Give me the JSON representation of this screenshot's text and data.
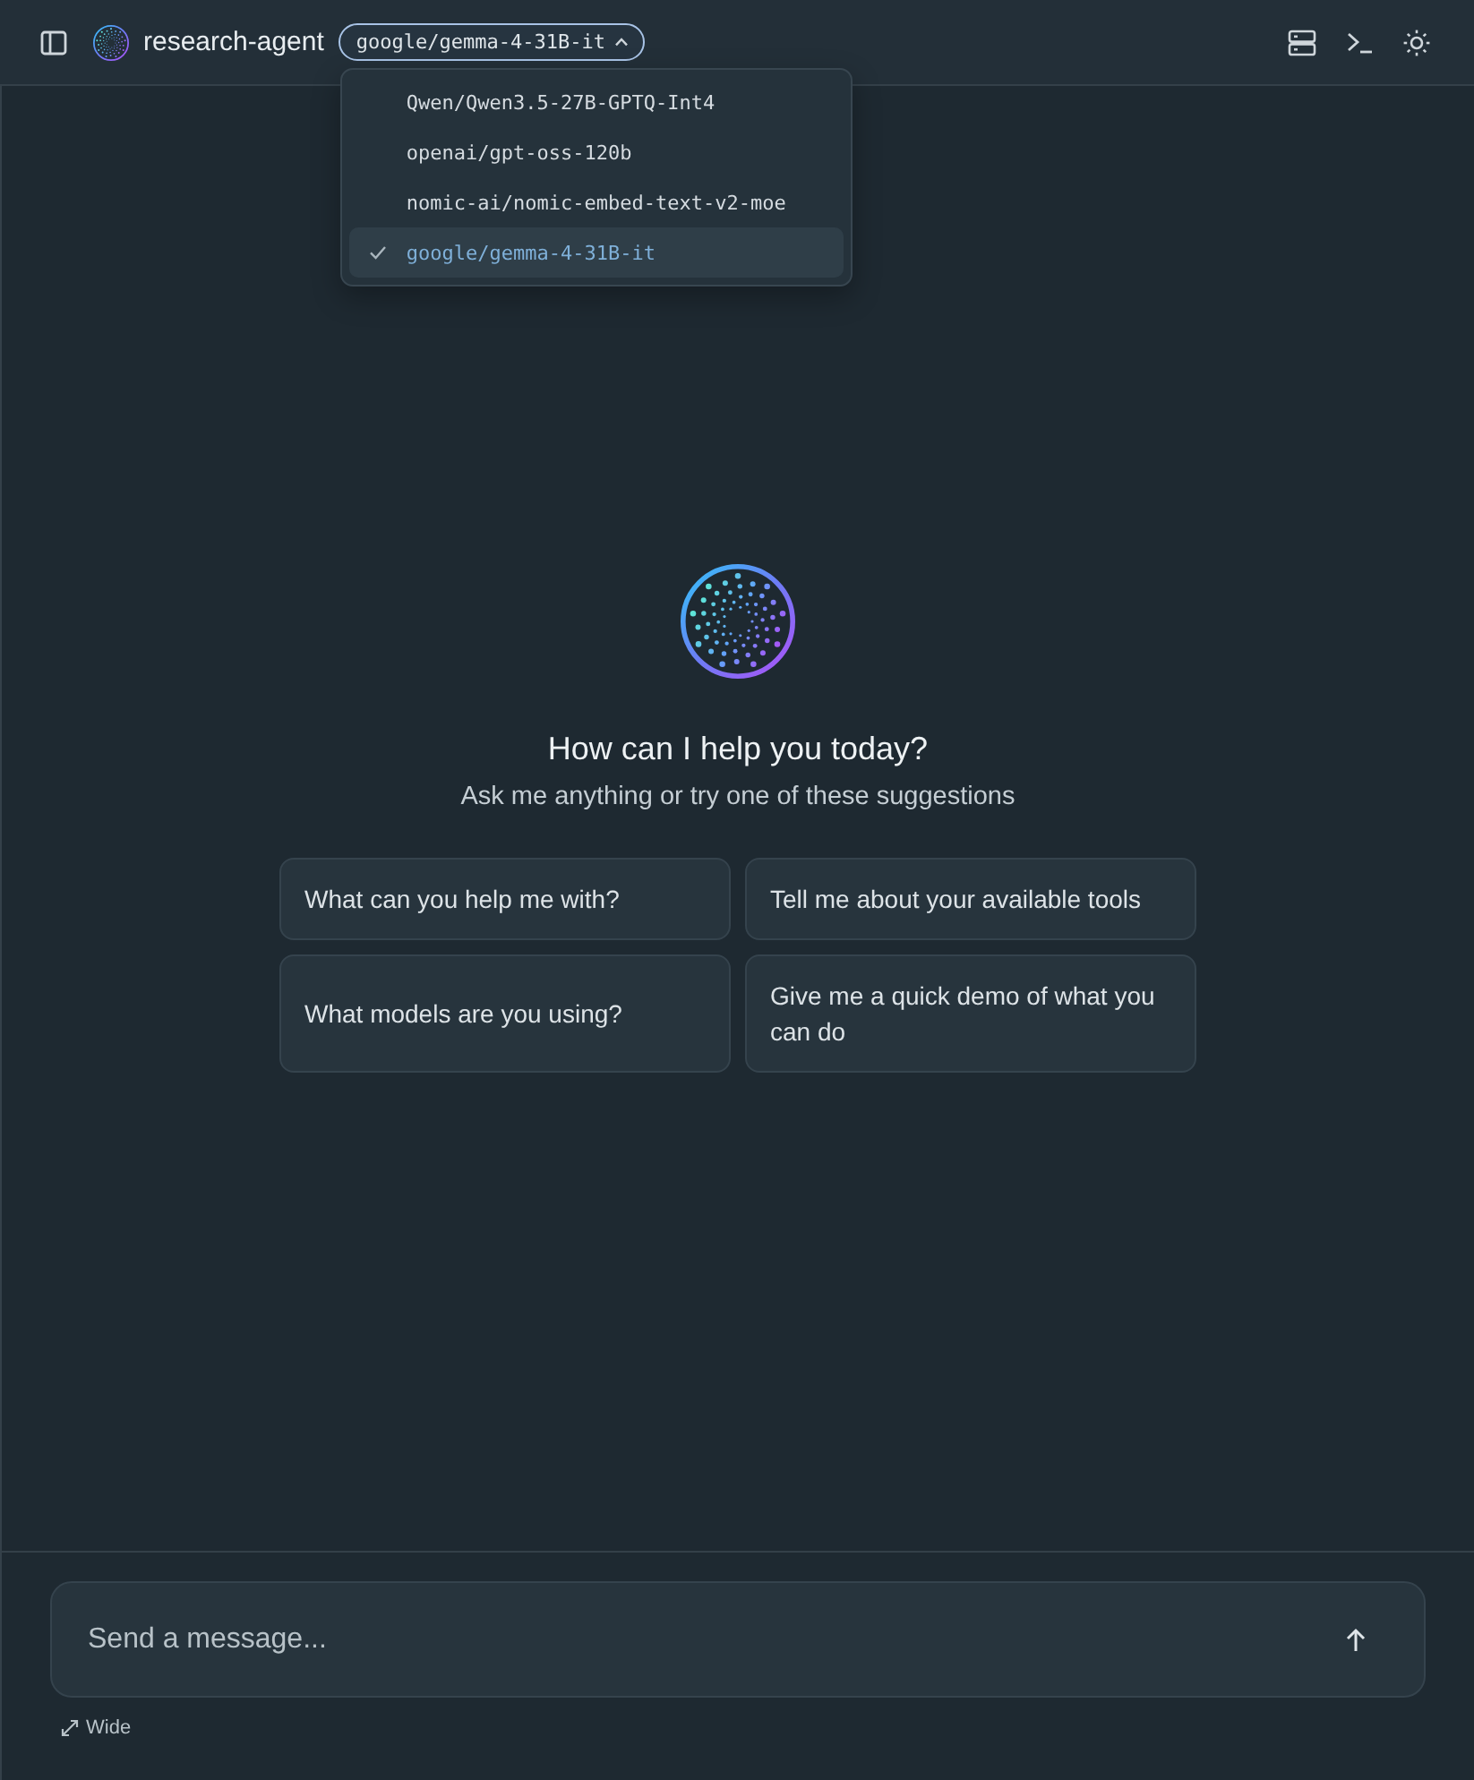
{
  "header": {
    "title": "research-agent",
    "model_selector": {
      "label": "google/gemma-4-31B-it",
      "expanded": true
    }
  },
  "model_menu": {
    "items": [
      {
        "label": "Qwen/Qwen3.5-27B-GPTQ-Int4",
        "selected": false
      },
      {
        "label": "openai/gpt-oss-120b",
        "selected": false
      },
      {
        "label": "nomic-ai/nomic-embed-text-v2-moe",
        "selected": false
      },
      {
        "label": "google/gemma-4-31B-it",
        "selected": true
      }
    ]
  },
  "welcome": {
    "heading": "How can I help you today?",
    "subheading": "Ask me anything or try one of these suggestions"
  },
  "suggestion_rows": [
    {
      "cards": [
        "What can you help me with?",
        "Tell me about your available tools"
      ]
    },
    {
      "cards": [
        "What models are you using?",
        "Give me a quick demo of what you can do"
      ]
    }
  ],
  "composer": {
    "placeholder": "Send a message..."
  },
  "width_toggle": {
    "label": "Wide"
  }
}
